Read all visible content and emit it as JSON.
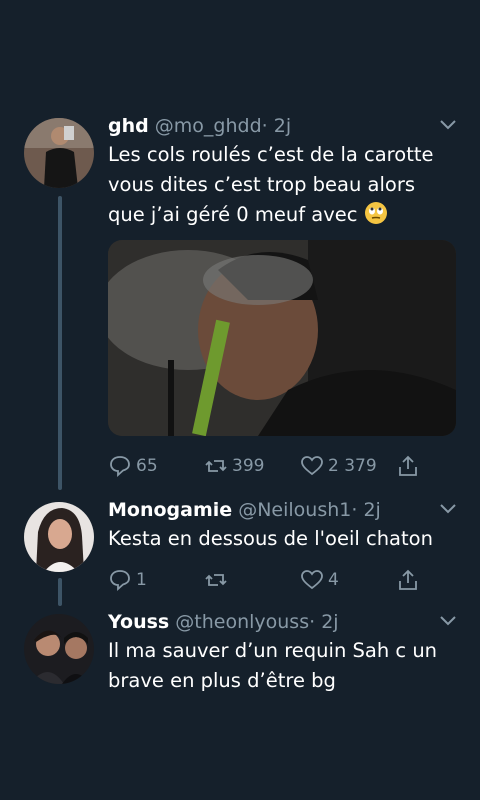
{
  "colors": {
    "background": "#15202b",
    "muted": "#8899a6",
    "thread_line": "#3d5466"
  },
  "tweets": [
    {
      "name": "ghd",
      "handle": "@mo_ghdd",
      "sep": "·",
      "time": "2j",
      "text": "Les cols roulés c’est de la carotte vous dites c’est trop beau alors que j’ai géré 0 meuf avec",
      "emoji": "face-with-rolling-eyes",
      "has_media": true,
      "replies": "65",
      "retweets": "399",
      "likes": "2 379"
    },
    {
      "name": "Monogamie",
      "handle": "@Neiloush1",
      "sep": "·",
      "time": "2j",
      "text": "Kesta en dessous de l'oeil chaton",
      "replies": "1",
      "retweets": "",
      "likes": "4"
    },
    {
      "name": "Youss",
      "handle": "@theonlyouss",
      "sep": "·",
      "time": "2j",
      "text": "Il ma sauver d’un requin Sah c un brave en plus d’être bg"
    }
  ]
}
